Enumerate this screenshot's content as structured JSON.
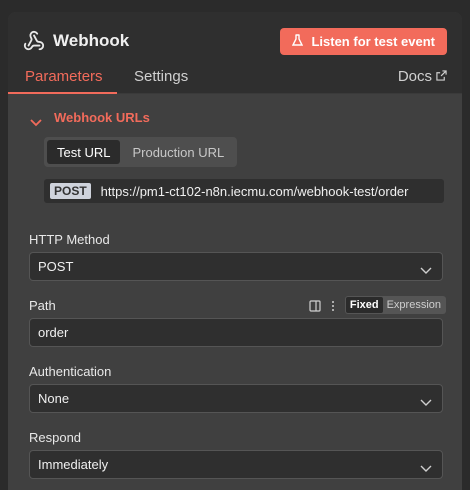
{
  "node": {
    "title": "Webhook",
    "listen_button": "Listen for test event"
  },
  "tabs": {
    "parameters": "Parameters",
    "settings": "Settings",
    "docs": "Docs"
  },
  "webhook_urls": {
    "section_label": "Webhook URLs",
    "segments": [
      "Test URL",
      "Production URL"
    ],
    "selected_segment": "Test URL",
    "method": "POST",
    "url": "https://pm1-ct102-n8n.iecmu.com/webhook-test/order"
  },
  "fields": {
    "http_method": {
      "label": "HTTP Method",
      "value": "POST"
    },
    "path": {
      "label": "Path",
      "value": "order",
      "mode_options": [
        "Fixed",
        "Expression"
      ],
      "selected_mode": "Fixed"
    },
    "authentication": {
      "label": "Authentication",
      "value": "None"
    },
    "respond": {
      "label": "Respond",
      "value": "Immediately"
    }
  },
  "colors": {
    "accent": "#f26b5b",
    "panel_bg": "#404040",
    "input_bg": "#2f2f2f"
  },
  "icons": {
    "node": "webhook-icon",
    "listen": "flask-icon",
    "docs": "external-link-icon",
    "section": "chevron-down-icon",
    "select": "chevron-down-icon",
    "path_tools": [
      "sidebar-toggle-icon",
      "more-vertical-icon"
    ]
  }
}
